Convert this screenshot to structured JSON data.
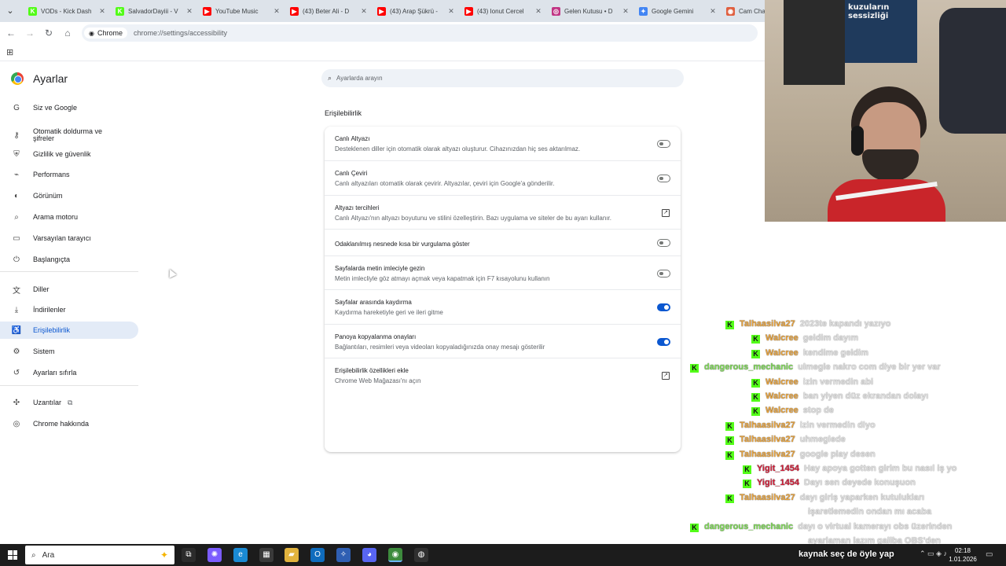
{
  "tabs": [
    {
      "title": "VODs - Kick Dash",
      "color": "#53fc18",
      "glyph": "K"
    },
    {
      "title": "SalvadorDayiii - V",
      "color": "#53fc18",
      "glyph": "K"
    },
    {
      "title": "YouTube Music",
      "color": "#ff0000",
      "glyph": "▶"
    },
    {
      "title": "(43) Beter Ali - D",
      "color": "#ff0000",
      "glyph": "▶"
    },
    {
      "title": "(43) Arap Şükrü -",
      "color": "#ff0000",
      "glyph": "▶"
    },
    {
      "title": "(43) Ionut Cercel",
      "color": "#ff0000",
      "glyph": "▶"
    },
    {
      "title": "Gelen Kutusu • D",
      "color": "#c13584",
      "glyph": "◎"
    },
    {
      "title": "Google Gemini",
      "color": "#4285f4",
      "glyph": "✦"
    },
    {
      "title": "Cam Chat",
      "color": "#e06040",
      "glyph": "◉"
    }
  ],
  "omnibox": {
    "chip": "Chrome",
    "url": "chrome://settings/accessibility"
  },
  "settings": {
    "title": "Ayarlar",
    "search_placeholder": "Ayarlarda arayın",
    "section_title": "Erişilebilirlik",
    "sidebar": [
      {
        "label": "Siz ve Google",
        "icon": "G"
      },
      {
        "label": "Otomatik doldurma ve şifreler",
        "icon": "⚷"
      },
      {
        "label": "Gizlilik ve güvenlik",
        "icon": "⛨"
      },
      {
        "label": "Performans",
        "icon": "⌁"
      },
      {
        "label": "Görünüm",
        "icon": "◐"
      },
      {
        "label": "Arama motoru",
        "icon": "⌕"
      },
      {
        "label": "Varsayılan tarayıcı",
        "icon": "▭"
      },
      {
        "label": "Başlangıçta",
        "icon": "⏻"
      },
      {
        "label": "Diller",
        "icon": "文"
      },
      {
        "label": "İndirilenler",
        "icon": "⤓"
      },
      {
        "label": "Erişilebilirlik",
        "icon": "♿"
      },
      {
        "label": "Sistem",
        "icon": "⚙"
      },
      {
        "label": "Ayarları sıfırla",
        "icon": "↺"
      },
      {
        "label": "Uzantılar",
        "icon": "✣"
      },
      {
        "label": "Chrome hakkında",
        "icon": "◎"
      }
    ],
    "rows": [
      {
        "title": "Canlı Altyazı",
        "desc": "Desteklenen diller için otomatik olarak altyazı oluşturur. Cihazınızdan hiç ses aktarılmaz.",
        "control": "toggle",
        "on": false
      },
      {
        "title": "Canlı Çeviri",
        "desc": "Canlı altyazıları otomatik olarak çevirir. Altyazılar, çeviri için Google'a gönderilir.",
        "control": "toggle",
        "on": false
      },
      {
        "title": "Altyazı tercihleri",
        "desc": "Canlı Altyazı'nın altyazı boyutunu ve stilini özelleştirin. Bazı uygulama ve siteler de bu ayarı kullanır.",
        "control": "launch",
        "on": false
      },
      {
        "title": "Odaklanılmış nesnede kısa bir vurgulama göster",
        "desc": "",
        "control": "toggle",
        "on": false
      },
      {
        "title": "Sayfalarda metin imleciyle gezin",
        "desc": "Metin imlecliyle göz atmayı açmak veya kapatmak için F7 kısayolunu kullanın",
        "control": "toggle",
        "on": false
      },
      {
        "title": "Sayfalar arasında kaydırma",
        "desc": "Kaydırma hareketiyle geri ve ileri gitme",
        "control": "toggle",
        "on": true
      },
      {
        "title": "Panoya kopyalanma onayları",
        "desc": "Bağlantıları, resimleri veya videoları kopyaladığınızda onay mesajı gösterilir",
        "control": "toggle",
        "on": true
      },
      {
        "title": "Erişilebilirlik özellikleri ekle",
        "desc": "Chrome Web Mağazası'nı açın",
        "control": "launch",
        "on": false
      }
    ]
  },
  "webcam": {
    "poster_title": "kuzuların sessizliği"
  },
  "chat": [
    {
      "user": "Talhaasilva27",
      "text": "2023te kapandı yazıyo",
      "color": "#e8a33d"
    },
    {
      "user": "Walcree",
      "text": "geldim dayım",
      "color": "#e8a33d"
    },
    {
      "user": "Walcree",
      "text": "kendime geldim",
      "color": "#e8a33d"
    },
    {
      "user": "dangerous_mechanic",
      "text": "ulmegle nakro com diye bir yer var",
      "color": "#7ed957"
    },
    {
      "user": "Walcree",
      "text": "izin vermedin abi",
      "color": "#e8a33d"
    },
    {
      "user": "Walcree",
      "text": "ban yiyen düz ekrandan dolayı",
      "color": "#e8a33d"
    },
    {
      "user": "Walcree",
      "text": "stop de",
      "color": "#e8a33d"
    },
    {
      "user": "Talhaasilva27",
      "text": "izin vermedin diyo",
      "color": "#e8a33d"
    },
    {
      "user": "Talhaasilva27",
      "text": "uhmeglede",
      "color": "#e8a33d"
    },
    {
      "user": "Talhaasilva27",
      "text": "google play desen",
      "color": "#e8a33d"
    },
    {
      "user": "Yigit_1454",
      "text": "Hay apoya gotten girim bu nasıl iş yo",
      "color": "#d0203a"
    },
    {
      "user": "Yigit_1454",
      "text": "Dayı sen deyede konuşuon",
      "color": "#d0203a"
    },
    {
      "user": "Talhaasilva27",
      "text": "dayı giriş yaparken kutulukları",
      "color": "#e8a33d"
    },
    {
      "user": "",
      "text": "işaretlemedin ondan mı acaba",
      "color": "#e8a33d"
    },
    {
      "user": "dangerous_mechanic",
      "text": "dayı o virtual kamerayı obs üzerinden",
      "color": "#7ed957"
    },
    {
      "user": "",
      "text": "ayarlaman lazım galiba OBS'den",
      "color": "#7ed957"
    }
  ],
  "taskbar": {
    "search_placeholder": "Ara",
    "overlay_text": "kaynak seç de öyle yap",
    "time": "02:18",
    "date": "1.01.2026",
    "apps": [
      {
        "name": "task-view-icon",
        "glyph": "⧉",
        "color": "#2b2b2b"
      },
      {
        "name": "copilot-icon",
        "glyph": "✺",
        "color": "#7b5cff"
      },
      {
        "name": "edge-icon",
        "glyph": "e",
        "color": "#1a8ad4"
      },
      {
        "name": "store-icon",
        "glyph": "▦",
        "color": "#3a3a3a"
      },
      {
        "name": "explorer-icon",
        "glyph": "▰",
        "color": "#e2b33d"
      },
      {
        "name": "outlook-icon",
        "glyph": "O",
        "color": "#0f6cbd"
      },
      {
        "name": "game-icon",
        "glyph": "✧",
        "color": "#2f5fb3"
      },
      {
        "name": "discord-icon",
        "glyph": "◕",
        "color": "#5865f2"
      },
      {
        "name": "chrome-icon",
        "glyph": "◉",
        "color": "#3d8b3d"
      },
      {
        "name": "obs-icon",
        "glyph": "◍",
        "color": "#303030"
      }
    ]
  }
}
